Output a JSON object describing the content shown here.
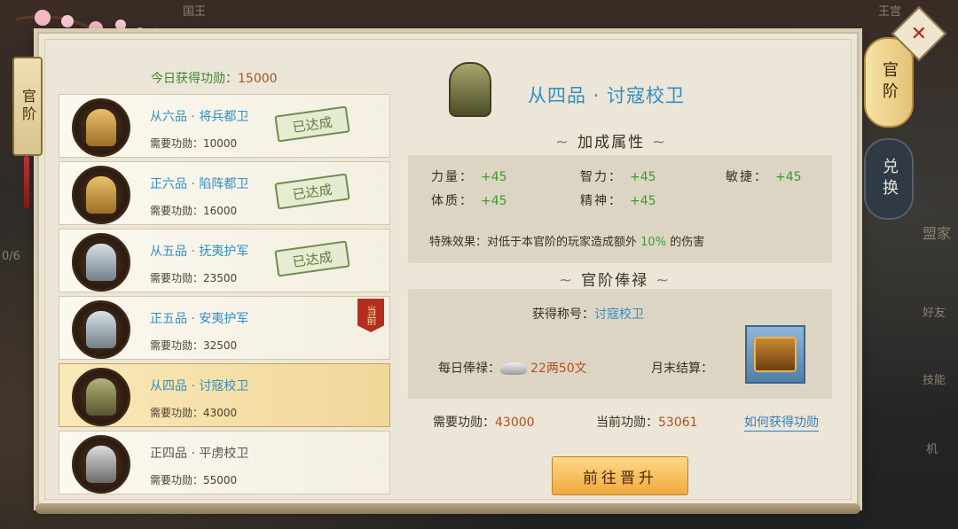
{
  "background": {
    "top_left_text": "国王",
    "top_right_text": "王宫",
    "side_left_text": "0/6",
    "side_right_texts": [
      "盟家",
      "好友",
      "技能",
      "机"
    ]
  },
  "left_tab": {
    "label": "官阶"
  },
  "right_tabs": [
    {
      "label": "官阶",
      "active": true
    },
    {
      "label": "兑换",
      "active": false
    }
  ],
  "today": {
    "label": "今日获得功勋：",
    "value": "15000"
  },
  "ranks": [
    {
      "name": "从六品 · 将兵都卫",
      "req_label": "需要功勋：",
      "req": "10000",
      "status": "已达成",
      "helmet": "gold-helmet-icon"
    },
    {
      "name": "正六品 · 陷阵都卫",
      "req_label": "需要功勋：",
      "req": "16000",
      "status": "已达成",
      "helmet": "gold-helmet-icon"
    },
    {
      "name": "从五品 · 抚夷护军",
      "req_label": "需要功勋：",
      "req": "23500",
      "status": "已达成",
      "helmet": "silver-helmet-icon"
    },
    {
      "name": "正五品 · 安夷护军",
      "req_label": "需要功勋：",
      "req": "32500",
      "status": "当前",
      "helmet": "silver-helmet-icon"
    },
    {
      "name": "从四品 · 讨寇校卫",
      "req_label": "需要功勋：",
      "req": "43000",
      "status": "selected",
      "helmet": "olive-helmet-icon"
    },
    {
      "name": "正四品 · 平虏校卫",
      "req_label": "需要功勋：",
      "req": "55000",
      "status": "locked",
      "helmet": "grey-helmet-icon"
    }
  ],
  "detail": {
    "title": "从四品 · 讨寇校卫",
    "bonus_heading": "加成属性",
    "attrs": [
      {
        "name": "力量：",
        "value": "+45"
      },
      {
        "name": "智力：",
        "value": "+45"
      },
      {
        "name": "敏捷：",
        "value": "+45"
      },
      {
        "name": "体质：",
        "value": "+45"
      },
      {
        "name": "精神：",
        "value": "+45"
      }
    ],
    "special_label": "特殊效果：对低于本官阶的玩家造成额外",
    "special_pct": "10%",
    "special_suffix": "的伤害",
    "salary_heading": "官阶俸禄",
    "title_label": "获得称号：",
    "title_value": "讨寇校卫",
    "daily_label": "每日俸禄：",
    "daily_value": "22两50文",
    "monthly_label": "月末结算：",
    "need_label": "需要功勋：",
    "need_value": "43000",
    "current_label": "当前功勋：",
    "current_value": "53061",
    "how_link": "如何获得功勋",
    "promote_button": "前往晋升"
  },
  "colors": {
    "accent_blue": "#2f8fc7",
    "green": "#3c9a2e",
    "orange": "#b0501e",
    "panel": "#ece6d8"
  }
}
